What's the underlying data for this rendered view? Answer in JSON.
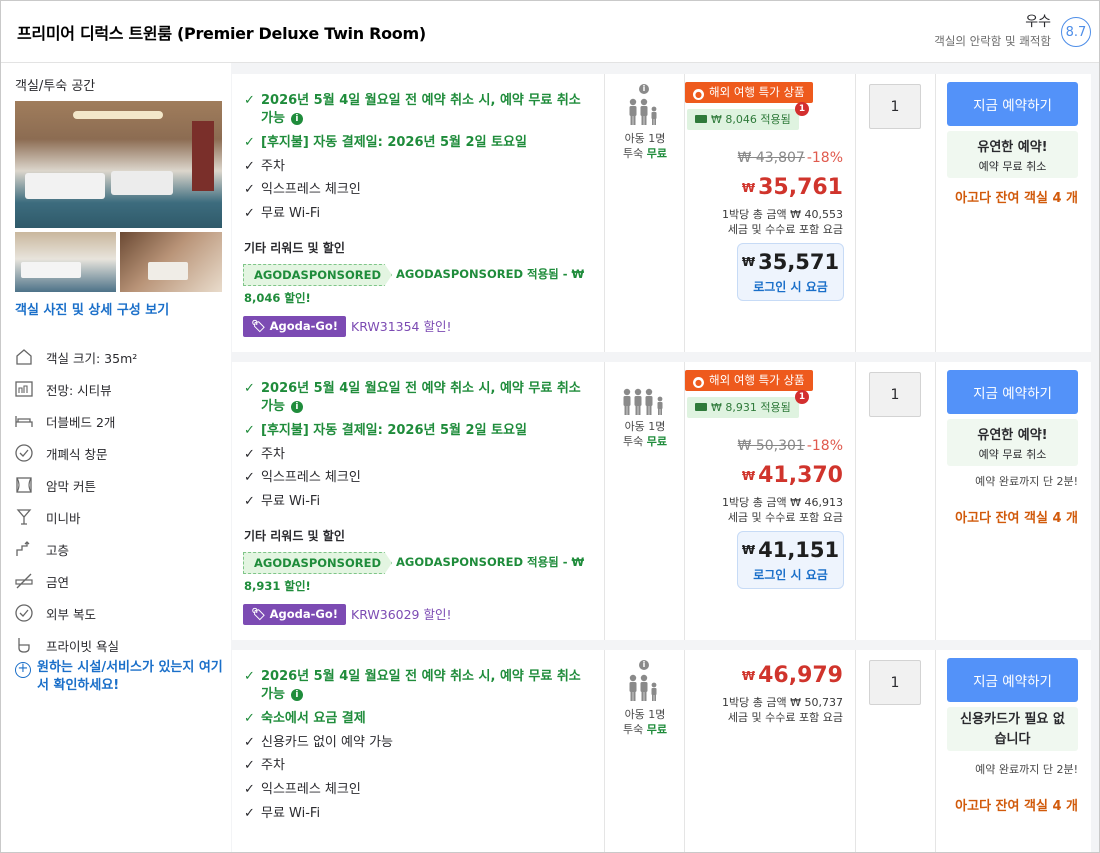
{
  "header": {
    "room_title": "프리미어 디럭스 트윈룸 (Premier Deluxe Twin Room)",
    "score_word": "우수",
    "score_sub": "객실의 안락함 및 쾌적함",
    "score": "8.7",
    "badge_color": "#4e8ee8"
  },
  "left": {
    "section_title": "객실/투숙 공간",
    "view_photos": "객실 사진 및 상세 구성 보기",
    "facilities": [
      {
        "icon": "room-size-icon",
        "label": "객실 크기: 35m²"
      },
      {
        "icon": "city-view-icon",
        "label": "전망: 시티뷰"
      },
      {
        "icon": "bed-icon",
        "label": "더블베드 2개"
      },
      {
        "icon": "window-check-icon",
        "label": "개폐식 창문"
      },
      {
        "icon": "blackout-curtain-icon",
        "label": "암막 커튼"
      },
      {
        "icon": "minibar-icon",
        "label": "미니바"
      },
      {
        "icon": "high-floor-icon",
        "label": "고층"
      },
      {
        "icon": "no-smoking-icon",
        "label": "금연"
      },
      {
        "icon": "hallway-check-icon",
        "label": "외부 복도"
      },
      {
        "icon": "private-bathroom-icon",
        "label": "프라이빗 욕실"
      }
    ],
    "more_facilities": "원하는 시설/서비스가 있는지 여기서 확인하세요!"
  },
  "offers": [
    {
      "benefits": [
        {
          "style": "green",
          "text": "2026년 5월 4일 월요일 전 예약 취소 시, 예약 무료 취소 가능",
          "info": true
        },
        {
          "style": "green",
          "text": "[후지불] 자동 결제일: 2026년 5월 2일 토요일",
          "info": false
        },
        {
          "style": "black",
          "text": "주차",
          "info": false
        },
        {
          "style": "black",
          "text": "익스프레스 체크인",
          "info": false
        },
        {
          "style": "black",
          "text": "무료 Wi-Fi",
          "info": false
        }
      ],
      "other_heading": "기타 리워드 및 할인",
      "sponsor_tag": "AGODASPONSORED",
      "sponsor_text_1": "AGODASPONSORED 적용됨 - ₩",
      "sponsor_text_2": "8,046 할인!",
      "agoda_go": "Agoda-Go!",
      "krw_discount": "KRW31354 할인!",
      "occupancy": {
        "adults": "아동 1명",
        "stay": "투숙",
        "free": "무료"
      },
      "deal_badge": "해외 여행 특가 상품",
      "applied_badge": "₩ 8,046 적용됨",
      "applied_count": "1",
      "original_price": "₩ 43,807",
      "discount_pct": "-18%",
      "currency": "₩",
      "final_price": "35,761",
      "note_1": "1박당 총 금액 ₩ 40,553",
      "note_2": "세금 및 수수료 포함 요금",
      "login_price": "35,571",
      "login_label": "로그인 시 요금",
      "quantity": "1",
      "book_label": "지금 예약하기",
      "flex_title": "유연한 예약!",
      "flex_sub": "예약 무료 취소",
      "book_note": "",
      "rooms_left": "아고다 잔여 객실 4 개"
    },
    {
      "benefits": [
        {
          "style": "green",
          "text": "2026년 5월 4일 월요일 전 예약 취소 시, 예약 무료 취소 가능",
          "info": true
        },
        {
          "style": "green",
          "text": "[후지불] 자동 결제일: 2026년 5월 2일 토요일",
          "info": false
        },
        {
          "style": "black",
          "text": "주차",
          "info": false
        },
        {
          "style": "black",
          "text": "익스프레스 체크인",
          "info": false
        },
        {
          "style": "black",
          "text": "무료 Wi-Fi",
          "info": false
        }
      ],
      "other_heading": "기타 리워드 및 할인",
      "sponsor_tag": "AGODASPONSORED",
      "sponsor_text_1": "AGODASPONSORED 적용됨 - ₩",
      "sponsor_text_2": "8,931 할인!",
      "agoda_go": "Agoda-Go!",
      "krw_discount": "KRW36029 할인!",
      "occupancy": {
        "adults": "아동 1명",
        "stay": "투숙",
        "free": "무료"
      },
      "deal_badge": "해외 여행 특가 상품",
      "applied_badge": "₩ 8,931 적용됨",
      "applied_count": "1",
      "original_price": "₩ 50,301",
      "discount_pct": "-18%",
      "currency": "₩",
      "final_price": "41,370",
      "note_1": "1박당 총 금액 ₩ 46,913",
      "note_2": "세금 및 수수료 포함 요금",
      "login_price": "41,151",
      "login_label": "로그인 시 요금",
      "quantity": "1",
      "book_label": "지금 예약하기",
      "flex_title": "유연한 예약!",
      "flex_sub": "예약 무료 취소",
      "book_note": "예약 완료까지 단 2분!",
      "rooms_left": "아고다 잔여 객실 4 개"
    },
    {
      "benefits": [
        {
          "style": "green",
          "text": "2026년 5월 4일 월요일 전 예약 취소 시, 예약 무료 취소 가능",
          "info": true
        },
        {
          "style": "green",
          "text": "숙소에서 요금 결제",
          "info": false
        },
        {
          "style": "black",
          "text": "신용카드 없이 예약 가능",
          "info": false
        },
        {
          "style": "black",
          "text": "주차",
          "info": false
        },
        {
          "style": "black",
          "text": "익스프레스 체크인",
          "info": false
        },
        {
          "style": "black",
          "text": "무료 Wi-Fi",
          "info": false
        }
      ],
      "occupancy": {
        "adults": "아동 1명",
        "stay": "투숙",
        "free": "무료"
      },
      "currency": "₩",
      "final_price": "46,979",
      "note_1": "1박당 총 금액 ₩ 50,737",
      "note_2": "세금 및 수수료 포함 요금",
      "quantity": "1",
      "book_label": "지금 예약하기",
      "flex_title": "신용카드가 필요 없습니다",
      "book_note": "예약 완료까지 단 2분!",
      "rooms_left": "아고다 잔여 객실 4 개"
    }
  ],
  "colors": {
    "accent_blue": "#5392f9",
    "green": "#1f8c3b",
    "price_red": "#d0342c",
    "orange": "#ee5a1d",
    "purple": "#7c4bb3",
    "rooms_left_orange": "#d15a0b"
  }
}
